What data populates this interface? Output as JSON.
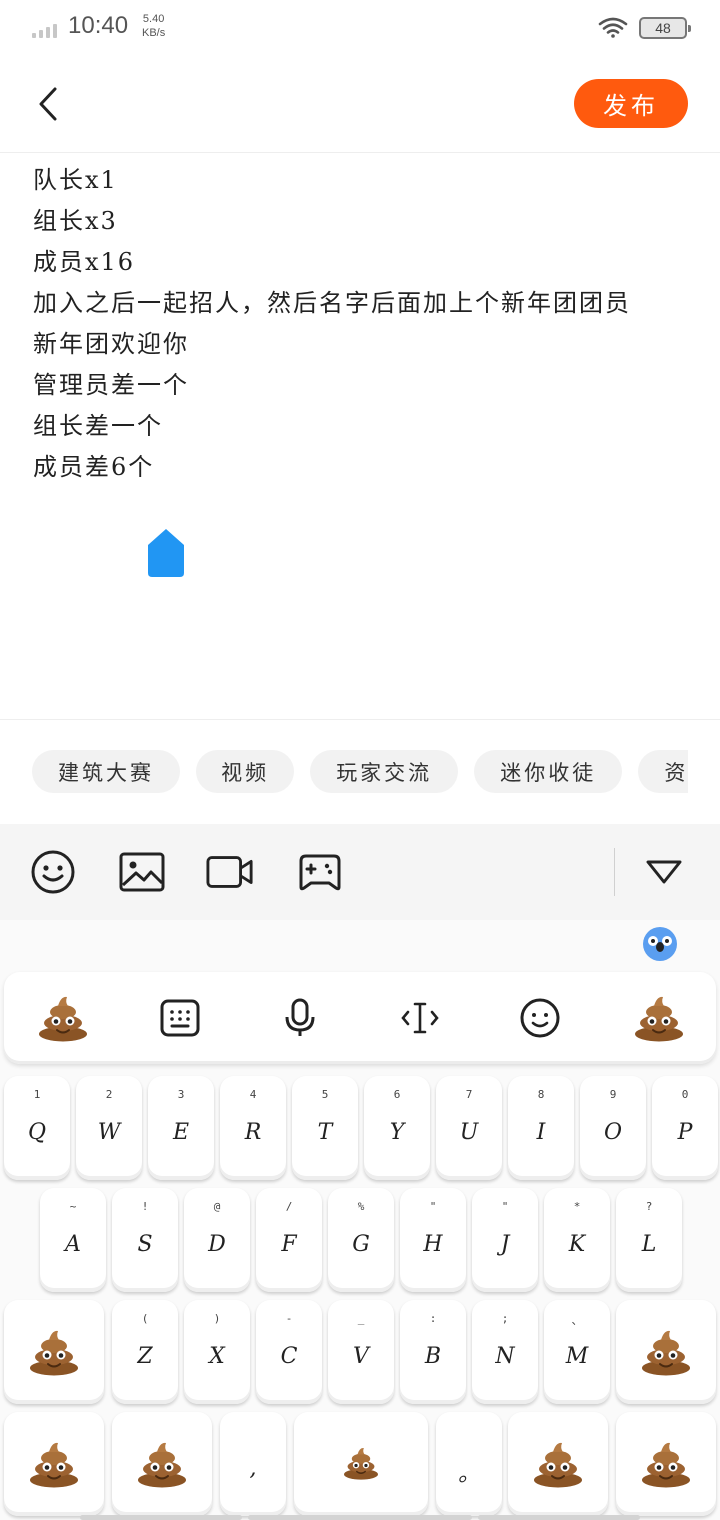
{
  "status": {
    "time": "10:40",
    "speed_value": "5.40",
    "speed_unit": "KB/s",
    "battery": "48"
  },
  "header": {
    "publish_label": "发布"
  },
  "editor": {
    "lines": [
      "队长x1",
      "组长x3",
      "成员x16",
      "加入之后一起招人，然后名字后面加上个新年团团员",
      "新年团欢迎你",
      "管理员差一个",
      "组长差一个",
      "成员差6个"
    ]
  },
  "tags": [
    "建筑大赛",
    "视频",
    "玩家交流",
    "迷你收徒",
    "资讯"
  ],
  "toolbar": {
    "icons": [
      "emoji-icon",
      "image-icon",
      "video-icon",
      "game-icon",
      "collapse-icon"
    ]
  },
  "keyboard": {
    "row1": [
      {
        "sub": "1",
        "key": "Q"
      },
      {
        "sub": "2",
        "key": "W"
      },
      {
        "sub": "3",
        "key": "E"
      },
      {
        "sub": "4",
        "key": "R"
      },
      {
        "sub": "5",
        "key": "T"
      },
      {
        "sub": "6",
        "key": "Y"
      },
      {
        "sub": "7",
        "key": "U"
      },
      {
        "sub": "8",
        "key": "I"
      },
      {
        "sub": "9",
        "key": "O"
      },
      {
        "sub": "0",
        "key": "P"
      }
    ],
    "row2": [
      {
        "sub": "~",
        "key": "A"
      },
      {
        "sub": "!",
        "key": "S"
      },
      {
        "sub": "@",
        "key": "D"
      },
      {
        "sub": "/",
        "key": "F"
      },
      {
        "sub": "%",
        "key": "G"
      },
      {
        "sub": "\"",
        "key": "H"
      },
      {
        "sub": "\"",
        "key": "J"
      },
      {
        "sub": "*",
        "key": "K"
      },
      {
        "sub": "?",
        "key": "L"
      }
    ],
    "row3": [
      {
        "sub": "(",
        "key": "Z"
      },
      {
        "sub": ")",
        "key": "X"
      },
      {
        "sub": "-",
        "key": "C"
      },
      {
        "sub": "_",
        "key": "V"
      },
      {
        "sub": ":",
        "key": "B"
      },
      {
        "sub": ";",
        "key": "N"
      },
      {
        "sub": "、",
        "key": "M"
      }
    ],
    "comma": ",",
    "period": "。"
  },
  "colors": {
    "accent": "#ff5a0e",
    "caret": "#2196f3"
  }
}
